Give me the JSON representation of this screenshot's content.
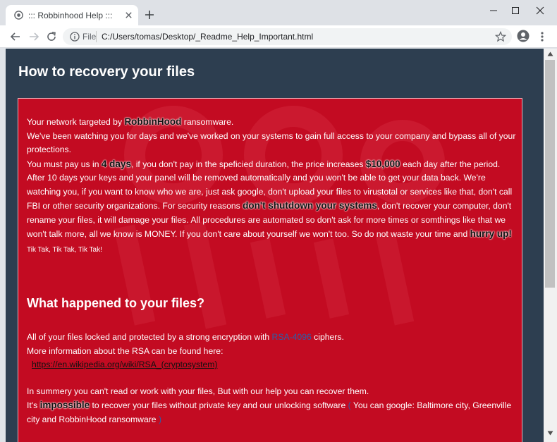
{
  "browser": {
    "tab_title": "::: Robbinhood Help :::",
    "url_scheme": "File",
    "url": "C:/Users/tomas/Desktop/_Readme_Help_Important.html"
  },
  "icons": {
    "favicon": "globe-icon",
    "tab_close": "close-icon",
    "new_tab": "plus-icon",
    "minimize": "minimize-icon",
    "maximize": "maximize-icon",
    "close": "close-icon",
    "back": "back-arrow-icon",
    "forward": "forward-arrow-icon",
    "reload": "reload-icon",
    "site_info": "info-icon",
    "bookmark": "star-icon",
    "profile": "account-circle-icon",
    "menu": "more-vert-icon"
  },
  "colors": {
    "page_background": "#2d3e50",
    "note_background": "#c30b22",
    "link_blue": "#2b5fa8"
  },
  "page": {
    "title": "How to recovery your files",
    "p1": {
      "l1_pre": "Your network targeted by ",
      "l1_brand": "RobbinHood",
      "l1_post": " ransomware.",
      "l2": "We've been watching you for days and we've worked on your systems to gain full access to your company and bypass all of your protections.",
      "l3_pre": "You must pay us in ",
      "days": "4 days",
      "l3_mid": ", if you don't pay in the speficied duration, the price increases ",
      "price": "$10,000",
      "l3_post": " each day after the period. After 10 days your keys and your panel will be removed automatically and you won't be able to get your data back. We're watching you, if you want to know who we are, just ask google, don't upload your files to virustotal or services like that, don't call FBI or other security organizations. For security reasons ",
      "no_shutdown": "don't shutdown your systems",
      "l3_end": ", don't recover your computer, don't rename your files, it will damage your files. All procedures are automated so don't ask for more times or somthings like that we won't talk more, all we know is MONEY. If you don't care about yourself we won't too. So do not waste your time and ",
      "hurry": "hurry up!",
      "tik": " Tik Tak, Tik Tak, Tik Tak!"
    },
    "section2": {
      "heading": "What happened to your files?",
      "l1_pre": "All of your files locked and protected by a strong encryption with ",
      "rsa": "RSA-4096",
      "l1_post": " ciphers.",
      "l2": "More information about the RSA can be found here:",
      "link": "https://en.wikipedia.org/wiki/RSA_(cryptosystem)",
      "l3": "In summery you can't read or work with your files, But with our help you can recover them.",
      "l4_pre": "It's ",
      "impossible": "impossible",
      "l4_post": " to recover your files without private key and our unlocking software",
      "l4_paren_open": " ( ",
      "l4_paren_text": "You can google: Baltimore city, Greenville city and RobbinHood ransomware",
      "l4_paren_close": " )",
      "cut_off": "... ... ... ... ... ... ... ... ... ... ..."
    }
  }
}
